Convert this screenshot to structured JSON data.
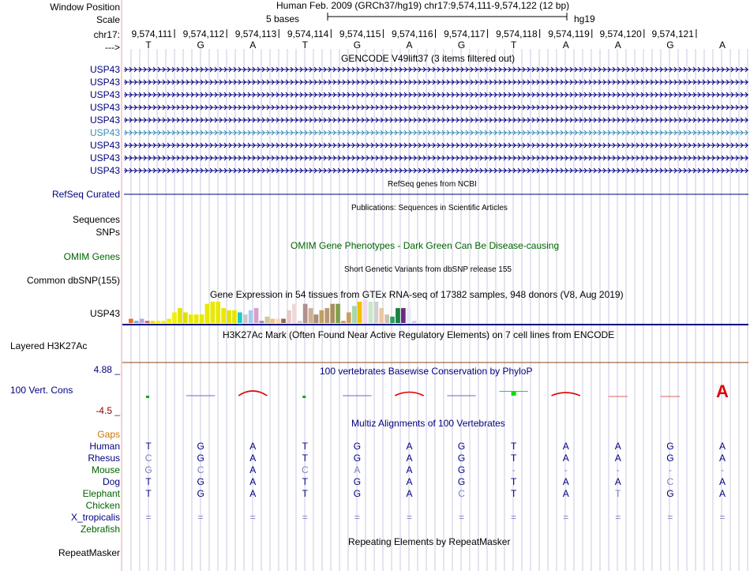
{
  "header": {
    "window_position_label": "Window Position",
    "scale_label": "Scale",
    "chrom_label": "chr17:",
    "strand_label": "--->",
    "position_text": "Human Feb. 2009 (GRCh37/hg19)   chr17:9,574,111-9,574,122 (12 bp)",
    "scale_text": "5 bases",
    "assembly": "hg19",
    "coordinates": [
      "9,574,111",
      "9,574,112",
      "9,574,113",
      "9,574,114",
      "9,574,115",
      "9,574,116",
      "9,574,117",
      "9,574,118",
      "9,574,119",
      "9,574,120",
      "9,574,121"
    ],
    "bases": [
      "T",
      "G",
      "A",
      "T",
      "G",
      "A",
      "G",
      "T",
      "A",
      "A",
      "G",
      "A"
    ]
  },
  "tracks": {
    "gencode_title": "GENCODE V49lift37 (3 items filtered out)",
    "gencode_items": [
      "USP43",
      "USP43",
      "USP43",
      "USP43",
      "USP43",
      "USP43",
      "USP43",
      "USP43",
      "USP43"
    ],
    "refseq_title": "RefSeq genes from NCBI",
    "refseq_label": "RefSeq Curated",
    "publications_title": "Publications: Sequences in Scientific Articles",
    "sequences_label": "Sequences",
    "snps_label": "SNPs",
    "omim_title": "OMIM Gene Phenotypes - Dark Green Can Be Disease-causing",
    "omim_label": "OMIM Genes",
    "dbsnp_title": "Short Genetic Variants from dbSNP release 155",
    "dbsnp_label": "Common dbSNP(155)",
    "gtex_title": "Gene Expression in 54 tissues from GTEx RNA-seq of 17382 samples, 948 donors (V8, Aug 2019)",
    "gtex_label": "USP43",
    "h3k27ac_title": "H3K27Ac Mark (Often Found Near Active Regulatory Elements) on 7 cell lines from ENCODE",
    "h3k27ac_label": "Layered H3K27Ac",
    "phylop_title": "100 vertebrates Basewise Conservation by PhyloP",
    "phylop_label": "100 Vert. Cons",
    "phylop_max": "4.88 _",
    "phylop_min": "-4.5 _",
    "multiz_title": "Multiz Alignments of 100 Vertebrates",
    "repeat_title": "Repeating Elements by RepeatMasker",
    "repeat_label": "RepeatMasker"
  },
  "alignment": {
    "gaps_label": "Gaps",
    "species": [
      {
        "name": "Human",
        "color": "#000080",
        "bases": [
          "T",
          "G",
          "A",
          "T",
          "G",
          "A",
          "G",
          "T",
          "A",
          "A",
          "G",
          "A"
        ]
      },
      {
        "name": "Rhesus",
        "color": "#000080",
        "bases": [
          "C",
          "G",
          "A",
          "T",
          "G",
          "A",
          "G",
          "T",
          "A",
          "A",
          "G",
          "A"
        ]
      },
      {
        "name": "Mouse",
        "color": "#006400",
        "bases": [
          "G",
          "C",
          "A",
          "C",
          "A",
          "A",
          "G",
          "-",
          "-",
          "-",
          "-",
          "-"
        ]
      },
      {
        "name": "Dog",
        "color": "#000080",
        "bases": [
          "T",
          "G",
          "A",
          "T",
          "G",
          "A",
          "G",
          "T",
          "A",
          "A",
          "C",
          "A"
        ]
      },
      {
        "name": "Elephant",
        "color": "#006400",
        "bases": [
          "T",
          "G",
          "A",
          "T",
          "G",
          "A",
          "C",
          "T",
          "A",
          "T",
          "G",
          "A"
        ]
      },
      {
        "name": "Chicken",
        "color": "#006400",
        "bases": [
          "",
          "",
          "",
          "",
          "",
          "",
          "",
          "",
          "",
          "",
          "",
          ""
        ]
      },
      {
        "name": "X_tropicalis",
        "color": "#000080",
        "bases": [
          "=",
          "=",
          "=",
          "=",
          "=",
          "=",
          "=",
          "=",
          "=",
          "=",
          "=",
          "="
        ]
      },
      {
        "name": "Zebrafish",
        "color": "#006400",
        "bases": [
          "",
          "",
          "",
          "",
          "",
          "",
          "",
          "",
          "",
          "",
          "",
          ""
        ]
      }
    ]
  },
  "gtex_expression": [
    2,
    1,
    2,
    1,
    1,
    1,
    1,
    2,
    5,
    7,
    5,
    4,
    4,
    4,
    9,
    10,
    10,
    7,
    6,
    6,
    5,
    4,
    6,
    7,
    1,
    3,
    2,
    2,
    2,
    6,
    9,
    1,
    9,
    7,
    4,
    6,
    7,
    9,
    9,
    1,
    5,
    8,
    10,
    11,
    10,
    10,
    7,
    4,
    3,
    7,
    7,
    7,
    1,
    1
  ],
  "phylop_values": [
    0.3,
    -0.2,
    2.0,
    0.3,
    -0.2,
    1.5,
    0.0,
    1.0,
    1.3,
    -0.4,
    -0.5,
    4.6
  ],
  "colors": {
    "track_label": "#000080",
    "omim": "#006400",
    "gaps_label": "#c87800",
    "phylop_min": "#8b0000",
    "h3k27ac_line": "#8b4513",
    "phylop_peak": "#e00000",
    "grid_line": "#c8c8e6",
    "left_border": "#e6a0a0"
  }
}
